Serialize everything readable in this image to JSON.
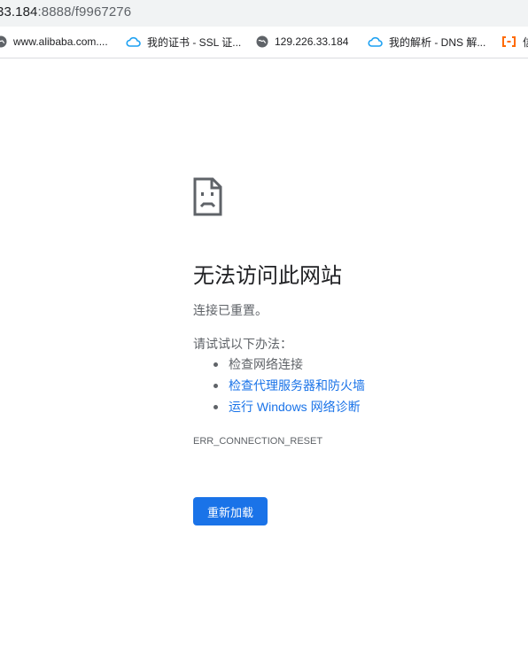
{
  "address_bar": {
    "host_visible": "33.184",
    "rest": ":8888/f9967276"
  },
  "bookmarks": [
    {
      "label": "www.alibaba.com....",
      "icon": "globe-icon"
    },
    {
      "label": "我的证书 - SSL 证...",
      "icon": "cloud-icon"
    },
    {
      "label": "129.226.33.184",
      "icon": "globe-icon"
    },
    {
      "label": "我的解析 - DNS 解...",
      "icon": "cloud-icon"
    },
    {
      "label": "信",
      "icon": "aliyun-icon"
    }
  ],
  "error_page": {
    "icon": "sad-document-icon",
    "title": "无法访问此网站",
    "subtitle": "连接已重置。",
    "try_label": "请试试以下办法：",
    "suggestions": [
      {
        "text": "检查网络连接",
        "link": false
      },
      {
        "text": "检查代理服务器和防火墙",
        "link": true
      },
      {
        "text": "运行 Windows 网络诊断",
        "link": true
      }
    ],
    "error_code": "ERR_CONNECTION_RESET",
    "reload_label": "重新加载"
  },
  "colors": {
    "accent": "#1a73e8",
    "cloud_icon": "#1da1f2",
    "aliyun_icon": "#ff6a00",
    "text_secondary": "#5f6368",
    "text_primary": "#202124"
  }
}
